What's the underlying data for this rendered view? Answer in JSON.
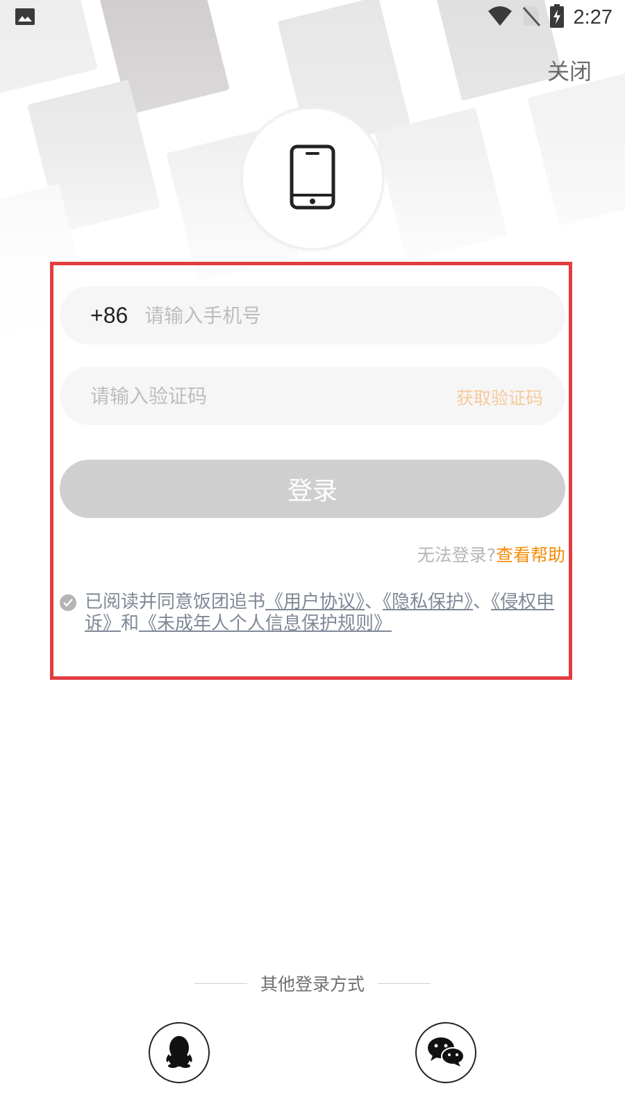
{
  "status_bar": {
    "time": "2:27",
    "icons": [
      "image-icon",
      "wifi-icon",
      "no-sim-icon",
      "battery-charging-icon"
    ]
  },
  "header": {
    "close_label": "关闭"
  },
  "hero": {
    "icon": "smartphone-icon"
  },
  "phone": {
    "country_code": "+86",
    "placeholder": "请输入手机号",
    "value": ""
  },
  "code": {
    "placeholder": "请输入验证码",
    "value": "",
    "get_code_label": "获取验证码"
  },
  "login": {
    "label": "登录"
  },
  "help": {
    "question": "无法登录?",
    "link": "查看帮助"
  },
  "agreement": {
    "prefix": "已阅读并同意饭团追书",
    "user_agreement": "《用户协议》",
    "sep1": "、",
    "privacy": "《隐私保护》",
    "sep2": "、",
    "infringement": "《侵权申诉》",
    "and": "和",
    "minor_rules": "《未成年人个人信息保护规则》"
  },
  "other_login": {
    "label": "其他登录方式",
    "options": [
      "qq-icon",
      "wechat-icon"
    ]
  },
  "colors": {
    "accent": "#f58a07",
    "highlight_border": "#e23c3f",
    "button_disabled": "#cfcfcf",
    "get_code_disabled": "#f7c99a"
  }
}
